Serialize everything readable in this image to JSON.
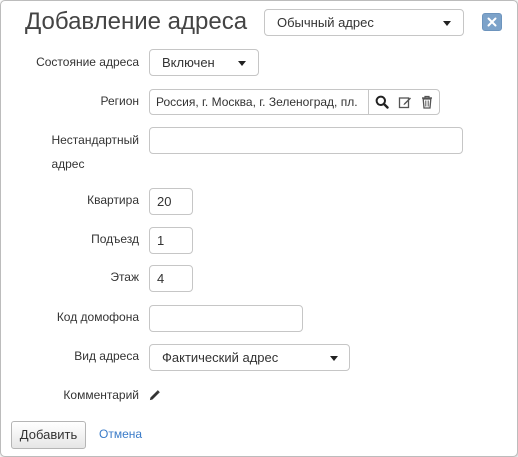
{
  "dialog": {
    "title": "Добавление адреса",
    "address_type": "Обычный адрес"
  },
  "form": {
    "state": {
      "label": "Состояние адреса",
      "value": "Включен"
    },
    "region": {
      "label": "Регион",
      "value": "Россия, г. Москва, г. Зеленоград, пл."
    },
    "nonstandard": {
      "label_line1": "Нестандартный",
      "label_line2": "адрес",
      "value": ""
    },
    "apartment": {
      "label": "Квартира",
      "value": "20"
    },
    "entrance": {
      "label": "Подъезд",
      "value": "1"
    },
    "floor": {
      "label": "Этаж",
      "value": "4"
    },
    "intercom": {
      "label": "Код домофона",
      "value": ""
    },
    "kind": {
      "label": "Вид адреса",
      "value": "Фактический адрес"
    },
    "comment": {
      "label": "Комментарий"
    }
  },
  "footer": {
    "add_label": "Добавить",
    "cancel_label": "Отмена"
  },
  "icons": {
    "close": "close-icon",
    "search": "search-icon",
    "edit": "edit-icon",
    "delete": "trash-icon",
    "comment_edit": "pencil-icon",
    "dropdown": "chevron-down-icon"
  },
  "colors": {
    "close_button": "#7ca2c9",
    "link": "#3a7bc8",
    "text": "#333333",
    "border": "#c6c6c6"
  }
}
